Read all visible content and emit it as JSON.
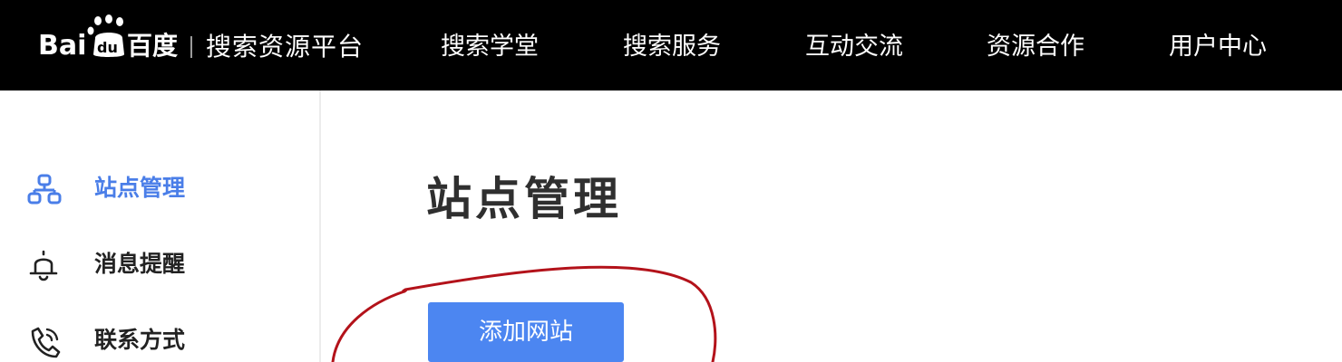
{
  "header": {
    "logo_text": "Bai du 百度",
    "platform_title": "搜索资源平台",
    "nav": [
      {
        "label": "搜索学堂"
      },
      {
        "label": "搜索服务"
      },
      {
        "label": "互动交流"
      },
      {
        "label": "资源合作"
      },
      {
        "label": "用户中心"
      }
    ]
  },
  "sidebar": {
    "items": [
      {
        "label": "站点管理",
        "icon": "sitemap-icon",
        "active": true
      },
      {
        "label": "消息提醒",
        "icon": "bell-icon",
        "active": false
      },
      {
        "label": "联系方式",
        "icon": "phone-icon",
        "active": false
      }
    ]
  },
  "main": {
    "title": "站点管理",
    "add_button_label": "添加网站"
  },
  "colors": {
    "topbar_bg": "#000000",
    "accent": "#4c86f1",
    "active_text": "#4a7ee8",
    "annotation": "#b3121a"
  }
}
